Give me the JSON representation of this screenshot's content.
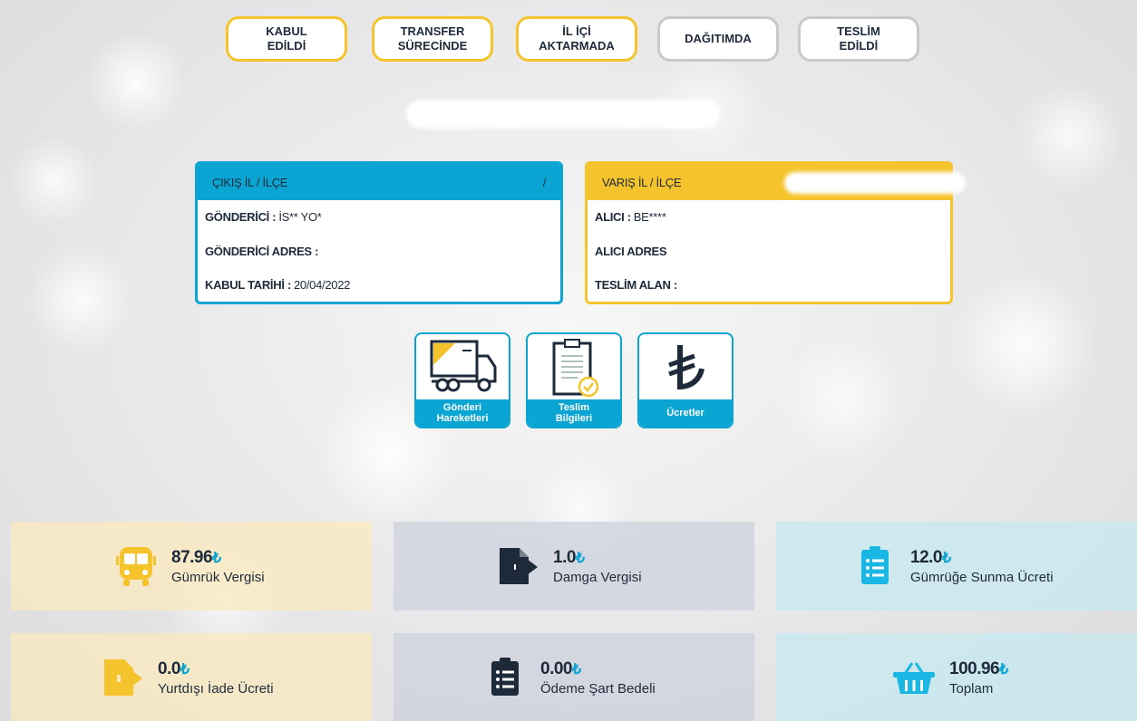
{
  "steps": [
    {
      "label": "KABUL\nEDİLDİ",
      "state": "done"
    },
    {
      "label": "TRANSFER\nSÜRECİNDE",
      "state": "done"
    },
    {
      "label": "İL İÇİ\nAKTARMADA",
      "state": "done"
    },
    {
      "label": "DAĞITIMDA",
      "state": "pending"
    },
    {
      "label": "TESLİM\nEDİLDİ",
      "state": "pending"
    }
  ],
  "origin": {
    "header": "ÇIKIŞ İL / İLÇE",
    "header_value": "/",
    "sender_label": "GÖNDERİCİ :",
    "sender_value": "İS** YO*",
    "address_label": "GÖNDERİCİ ADRES :",
    "address_value": "",
    "date_label": "KABUL TARİHİ :",
    "date_value": "20/04/2022"
  },
  "destination": {
    "header": "VARIŞ İL / İLÇE",
    "receiver_label": "ALICI :",
    "receiver_value": "BE****",
    "address_label": "ALICI ADRES",
    "received_by_label": "TESLİM ALAN :",
    "received_by_value": ""
  },
  "tiles": [
    {
      "label": "Gönderi\nHareketleri",
      "icon": "truck-icon"
    },
    {
      "label": "Teslim\nBilgileri",
      "icon": "clipboard-check-icon"
    },
    {
      "label": "Ücretler",
      "icon": "lira-icon"
    }
  ],
  "currency": "₺",
  "fees": [
    {
      "amount": "87.96",
      "name": "Gümrük Vergisi",
      "icon": "bus-icon"
    },
    {
      "amount": "1.0",
      "name": "Damga Vergisi",
      "icon": "file-export-icon"
    },
    {
      "amount": "12.0",
      "name": "Gümrüğe Sunma Ücreti",
      "icon": "clipboard-list-icon"
    },
    {
      "amount": "0.0",
      "name": "Yurtdışı İade Ücreti",
      "icon": "file-export-icon"
    },
    {
      "amount": "0.00",
      "name": "Ödeme Şart Bedeli",
      "icon": "clipboard-list-icon"
    },
    {
      "amount": "100.96",
      "name": "Toplam",
      "icon": "basket-icon"
    }
  ],
  "colors": {
    "blue": "#0aa5d2",
    "yellow": "#f5c42d",
    "navy": "#1e2a3a",
    "inactive_border": "#c9c9c9"
  }
}
